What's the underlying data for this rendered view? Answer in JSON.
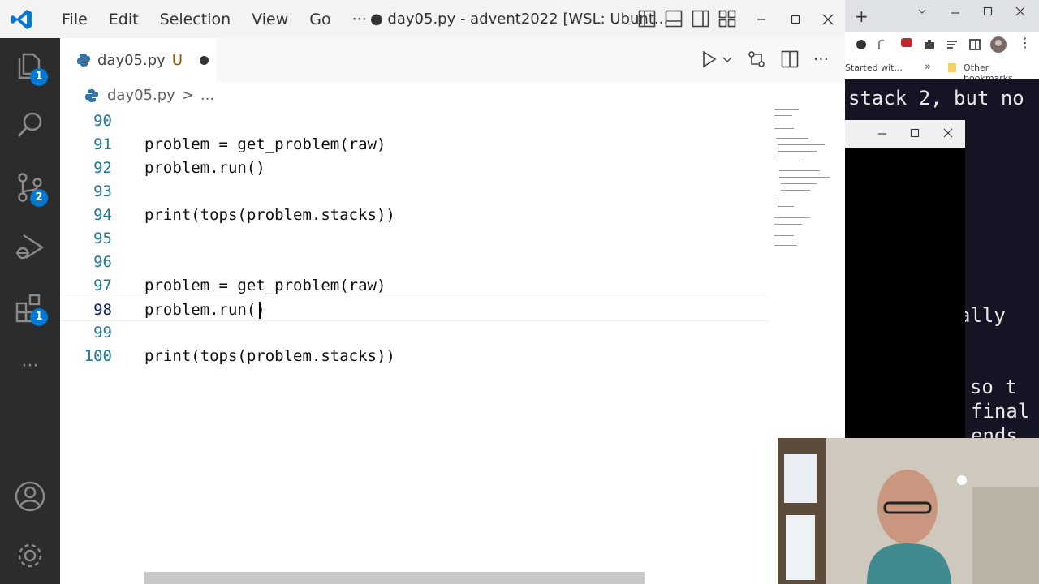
{
  "titlebar": {
    "menu": [
      "File",
      "Edit",
      "Selection",
      "View",
      "Go",
      "···"
    ],
    "title": "● day05.py - advent2022 [WSL: Ubunt..."
  },
  "activity": {
    "explorer_badge": "1",
    "scm_badge": "2",
    "extensions_badge": "1",
    "more": "···"
  },
  "tab": {
    "filename": "day05.py",
    "status": "U"
  },
  "tab_actions": {
    "more": "···"
  },
  "breadcrumb": {
    "file": "day05.py",
    "sep": ">",
    "rest": "..."
  },
  "editor": {
    "lines": [
      {
        "num": "90",
        "code": ""
      },
      {
        "num": "91",
        "code": "problem = get_problem(raw)"
      },
      {
        "num": "92",
        "code": "problem.run()"
      },
      {
        "num": "93",
        "code": ""
      },
      {
        "num": "94",
        "code": "print(tops(problem.stacks))"
      },
      {
        "num": "95",
        "code": ""
      },
      {
        "num": "96",
        "code": ""
      },
      {
        "num": "97",
        "code": "problem = get_problem(raw)"
      },
      {
        "num": "98",
        "code": "problem.run()"
      },
      {
        "num": "99",
        "code": ""
      },
      {
        "num": "100",
        "code": "print(tops(problem.stacks))"
      }
    ]
  },
  "browser": {
    "new_tab": "+",
    "bookmark_left": "Started wit...",
    "bookmark_more": "»",
    "bookmark_other": "Other bookmarks",
    "terminal_lines": [
      "stack 2, but no",
      "ally",
      "n so t",
      "final",
      "ends"
    ]
  },
  "colors": {
    "accent": "#0078d4",
    "activitybar": "#2c2c2c",
    "keyword_fn": "#795e26",
    "line_number": "#237893"
  }
}
